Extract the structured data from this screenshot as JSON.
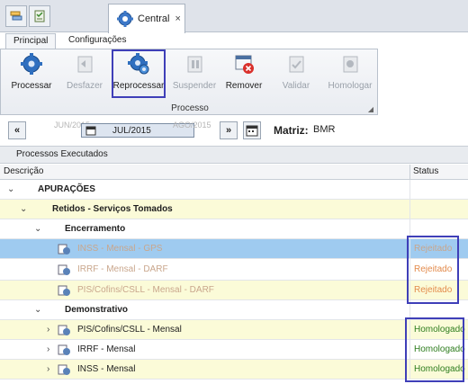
{
  "document_tab": {
    "label": "Central",
    "close": "×"
  },
  "ribbon_tabs": [
    "Principal",
    "Configurações"
  ],
  "ribbon_buttons": {
    "processar": "Processar",
    "desfazer": "Desfazer",
    "reprocessar": "Reprocessar",
    "suspender": "Suspender",
    "remover": "Remover",
    "validar": "Validar",
    "homologar": "Homologar"
  },
  "ribbon_group": "Processo",
  "period_nav": {
    "prev_btn": "«",
    "next_btn": "»",
    "prev_period": "JUN/2015",
    "current_period": "JUL/2015",
    "next_period": "AGO/2015"
  },
  "matriz": {
    "label": "Matriz:",
    "value": "BMR"
  },
  "panel_title": "Processos Executados",
  "columns": {
    "descricao": "Descrição",
    "status": "Status"
  },
  "rows": [
    {
      "text": "APURAÇÕES",
      "status": ""
    },
    {
      "text": "Retidos - Serviços Tomados",
      "status": ""
    },
    {
      "text": "Encerramento",
      "status": ""
    },
    {
      "text": "INSS - Mensal - GPS",
      "status": "Rejeitado"
    },
    {
      "text": "IRRF - Mensal - DARF",
      "status": "Rejeitado"
    },
    {
      "text": "PIS/Cofins/CSLL - Mensal - DARF",
      "status": "Rejeitado"
    },
    {
      "text": "Demonstrativo",
      "status": ""
    },
    {
      "text": "PIS/Cofins/CSLL - Mensal",
      "status": "Homologado"
    },
    {
      "text": "IRRF - Mensal",
      "status": "Homologado"
    },
    {
      "text": "INSS - Mensal",
      "status": "Homologado"
    }
  ],
  "colors": {
    "rejected": "#e38b4c",
    "approved": "#2e7d1e",
    "selected_row": "#9fcbf0",
    "highlight_row": "#fbfbd8",
    "annotation_box": "#3f3fb8"
  }
}
